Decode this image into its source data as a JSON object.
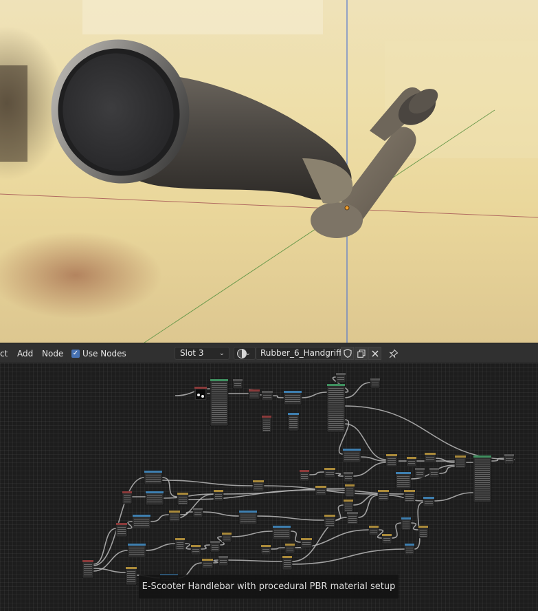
{
  "header": {
    "select_label": "ct",
    "add_label": "Add",
    "node_label": "Node",
    "use_nodes_label": "Use Nodes",
    "use_nodes_checked": true,
    "slot_value": "Slot 3",
    "material_name": "Rubber_6_Handgriff",
    "icons": [
      "chevron-down-icon",
      "material-sphere-icon",
      "shield-icon",
      "copy-icon",
      "close-icon",
      "pin-icon"
    ]
  },
  "caption": "E-Scooter Handlebar with procedural PBR material setup",
  "colors": {
    "header_bg": "#303030",
    "editor_bg": "#1d1d1d",
    "accent_blue": "#4772b3",
    "node_body": "#2f2f2f",
    "link": "#b8b8b8"
  }
}
